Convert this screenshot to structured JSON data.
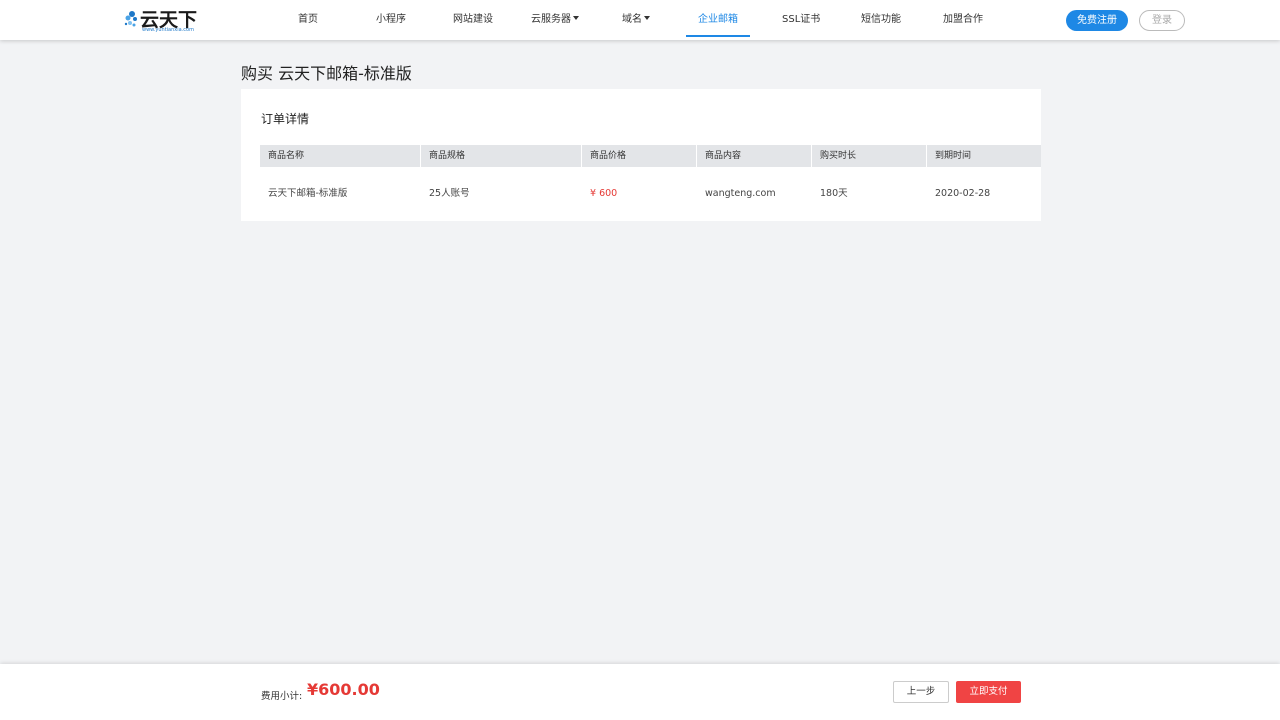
{
  "header": {
    "logo_text": "云天下",
    "logo_sub": "www.yuntianxia.com",
    "nav": [
      {
        "label": "首页"
      },
      {
        "label": "小程序"
      },
      {
        "label": "网站建设"
      },
      {
        "label": "云服务器",
        "dropdown": true
      },
      {
        "label": "域名",
        "dropdown": true
      },
      {
        "label": "企业邮箱",
        "active": true
      },
      {
        "label": "SSL证书"
      },
      {
        "label": "短信功能"
      },
      {
        "label": "加盟合作"
      }
    ],
    "register_label": "免费注册",
    "login_label": "登录",
    "accent_color": "#1e88e5"
  },
  "page": {
    "title": "购买 云天下邮箱-标准版"
  },
  "order": {
    "section_title": "订单详情",
    "columns": [
      "商品名称",
      "商品规格",
      "商品价格",
      "商品内容",
      "购买时长",
      "到期时间"
    ],
    "rows": [
      [
        "云天下邮箱-标准版",
        "25人账号",
        "¥ 600",
        "wangteng.com",
        "180天",
        "2020-02-28"
      ]
    ]
  },
  "footer": {
    "fee_label": "费用小计:",
    "fee_amount": "¥600.00",
    "prev_label": "上一步",
    "pay_label": "立即支付",
    "price_color": "#e53935"
  }
}
